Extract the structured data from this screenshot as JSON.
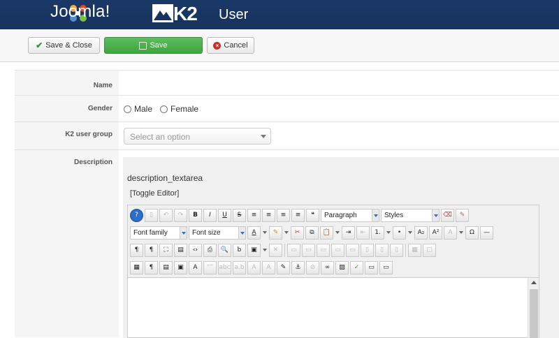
{
  "header": {
    "brand": "Joomla!",
    "k2_label": "K2",
    "page_title": "User"
  },
  "toolbar": {
    "save_close": "Save & Close",
    "save": "Save",
    "cancel": "Cancel"
  },
  "form": {
    "name_label": "Name",
    "gender_label": "Gender",
    "gender_male": "Male",
    "gender_female": "Female",
    "group_label": "K2 user group",
    "group_placeholder": "Select an option",
    "description_label": "Description"
  },
  "editor": {
    "textarea_name": "description_textarea",
    "toggle": "[Toggle Editor]",
    "format_select": "Paragraph",
    "styles_select": "Styles",
    "font_family_select": "Font family",
    "font_size_select": "Font size"
  },
  "colors": {
    "header_bg": "#17325c",
    "save_green": "#46a546",
    "cancel_red": "#c9302c"
  }
}
